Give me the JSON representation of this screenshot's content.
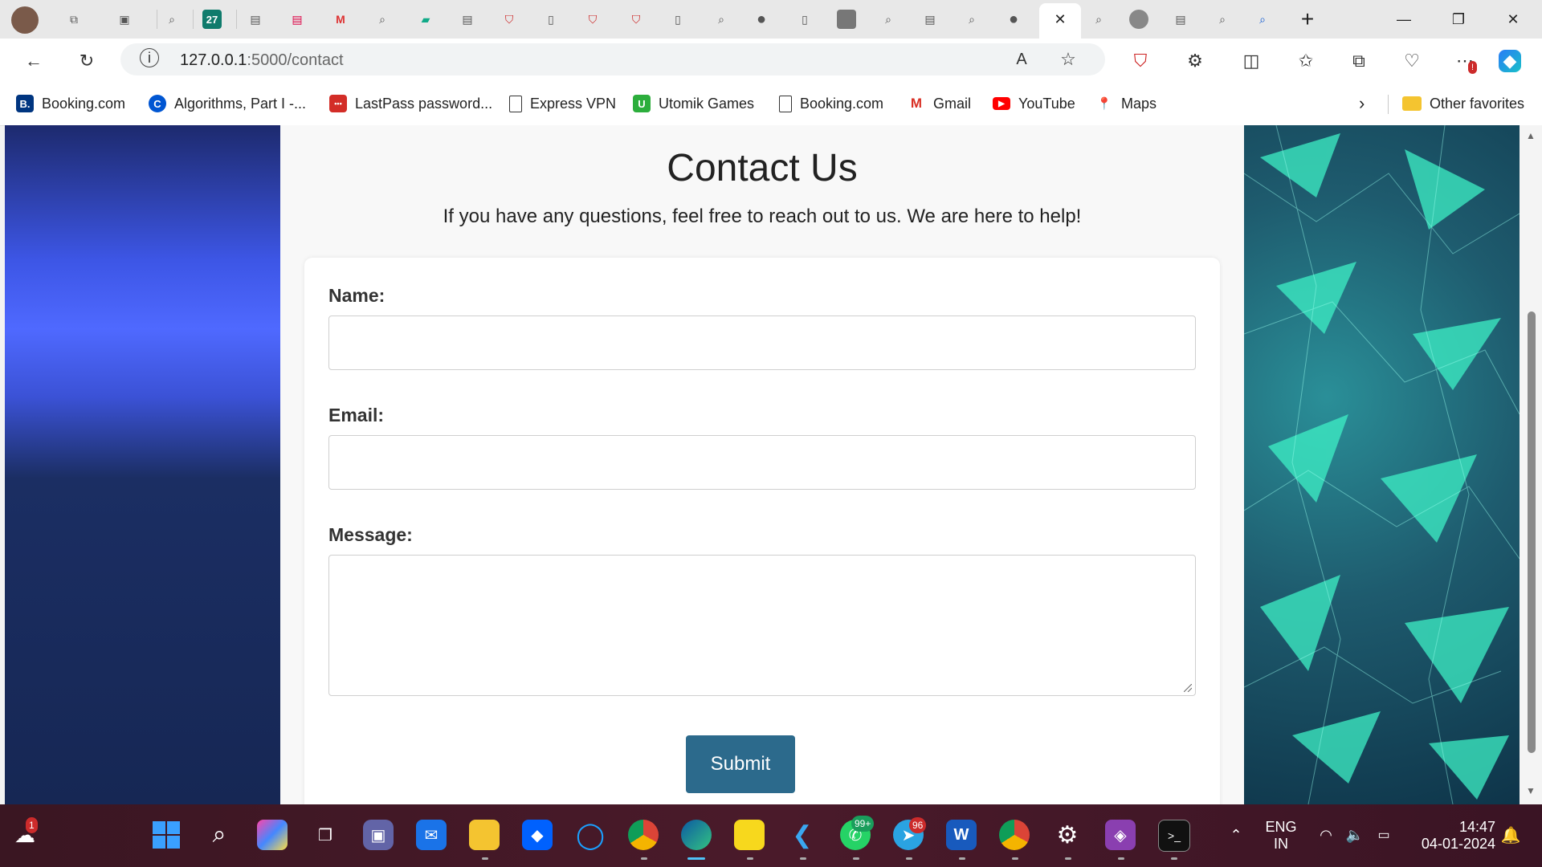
{
  "browser": {
    "address_bar": {
      "url_host": "127.0.0.1",
      "url_path": ":5000/contact"
    },
    "active_tab_close_glyph": "✕",
    "tab_favicon_badge": "27",
    "favorites": [
      {
        "label": "Booking.com",
        "icon": "booking-icon",
        "color": "#003580",
        "glyph": "B."
      },
      {
        "label": "Algorithms, Part I -...",
        "icon": "coursera-icon",
        "color": "#0056d2",
        "glyph": "C"
      },
      {
        "label": "LastPass password...",
        "icon": "lastpass-icon",
        "color": "#d32d27",
        "glyph": "•••"
      },
      {
        "label": "Express VPN",
        "icon": "page-icon",
        "color": "#ffffff",
        "glyph": ""
      },
      {
        "label": "Utomik Games",
        "icon": "utomik-icon",
        "color": "#2cae3c",
        "glyph": "U"
      },
      {
        "label": "Booking.com",
        "icon": "page-icon",
        "color": "#ffffff",
        "glyph": ""
      },
      {
        "label": "Gmail",
        "icon": "gmail-icon",
        "color": "#ffffff",
        "glyph": "M"
      },
      {
        "label": "YouTube",
        "icon": "youtube-icon",
        "color": "#ff0000",
        "glyph": "▶"
      },
      {
        "label": "Maps",
        "icon": "maps-icon",
        "color": "#ffffff",
        "glyph": "📍"
      }
    ],
    "other_favorites_label": "Other favorites",
    "extension_badge": "!"
  },
  "page": {
    "title": "Contact Us",
    "subtitle": "If you have any questions, feel free to reach out to us. We are here to help!",
    "form": {
      "name_label": "Name:",
      "name_value": "",
      "email_label": "Email:",
      "email_value": "",
      "message_label": "Message:",
      "message_value": "",
      "submit_label": "Submit"
    }
  },
  "taskbar": {
    "notification_badge": "1",
    "whatsapp_badge": "99+",
    "telegram_badge": "96",
    "language_line1": "ENG",
    "language_line2": "IN",
    "time": "14:47",
    "date": "04-01-2024",
    "word_glyph": "W"
  },
  "colors": {
    "accent_button": "#2c6a8c",
    "taskbar": "#4a1a2a"
  }
}
